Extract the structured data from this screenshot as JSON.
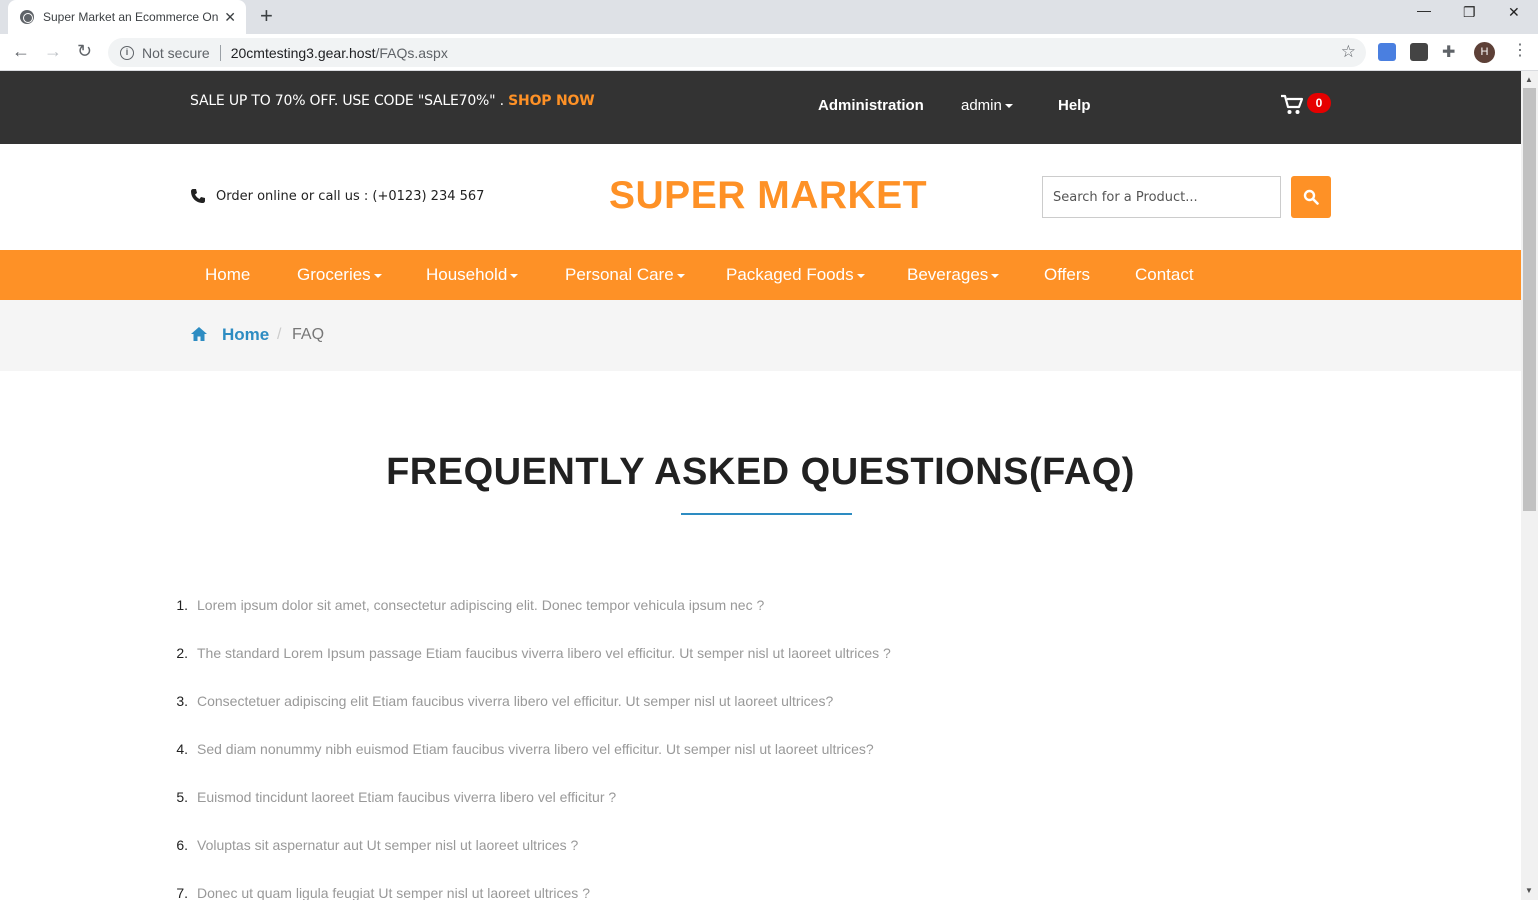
{
  "browser": {
    "tab_title": "Super Market an Ecommerce Online",
    "not_secure": "Not secure",
    "url_host": "20cmtesting3.gear.host",
    "url_path": "/FAQs.aspx",
    "profile_initial": "H"
  },
  "topbar": {
    "promo_text": "SALE UP TO 70% OFF. USE CODE \"SALE70%\" .",
    "promo_link": "SHOP NOW",
    "administration": "Administration",
    "admin": "admin",
    "help": "Help",
    "cart_count": "0"
  },
  "header": {
    "phone_text": "Order online or call us : (+0123) 234 567",
    "logo": "SUPER MARKET",
    "search_placeholder": "Search for a Product..."
  },
  "nav": {
    "items": [
      {
        "label": "Home"
      },
      {
        "label": "Groceries"
      },
      {
        "label": "Household"
      },
      {
        "label": "Personal Care"
      },
      {
        "label": "Packaged Foods"
      },
      {
        "label": "Beverages"
      },
      {
        "label": "Offers"
      },
      {
        "label": "Contact"
      }
    ]
  },
  "breadcrumb": {
    "home": "Home",
    "separator": "/",
    "current": "FAQ"
  },
  "faq": {
    "title": "FREQUENTLY ASKED QUESTIONS(FAQ)",
    "questions": [
      {
        "num": "1.",
        "text": "Lorem ipsum dolor sit amet, consectetur adipiscing elit. Donec tempor vehicula ipsum nec ?"
      },
      {
        "num": "2.",
        "text": "The standard Lorem Ipsum passage Etiam faucibus viverra libero vel efficitur. Ut semper nisl ut laoreet ultrices ?"
      },
      {
        "num": "3.",
        "text": "Consectetuer adipiscing elit Etiam faucibus viverra libero vel efficitur. Ut semper nisl ut laoreet ultrices?"
      },
      {
        "num": "4.",
        "text": "Sed diam nonummy nibh euismod Etiam faucibus viverra libero vel efficitur. Ut semper nisl ut laoreet ultrices?"
      },
      {
        "num": "5.",
        "text": "Euismod tincidunt laoreet Etiam faucibus viverra libero vel efficitur ?"
      },
      {
        "num": "6.",
        "text": "Voluptas sit aspernatur aut Ut semper nisl ut laoreet ultrices ?"
      },
      {
        "num": "7.",
        "text": "Donec ut quam ligula feugiat Ut semper nisl ut laoreet ultrices ?"
      }
    ]
  },
  "colors": {
    "brand_orange": "#fe9126",
    "link_blue": "#2d8cc2",
    "topbar_bg": "#333333",
    "cart_badge": "#e60000"
  }
}
